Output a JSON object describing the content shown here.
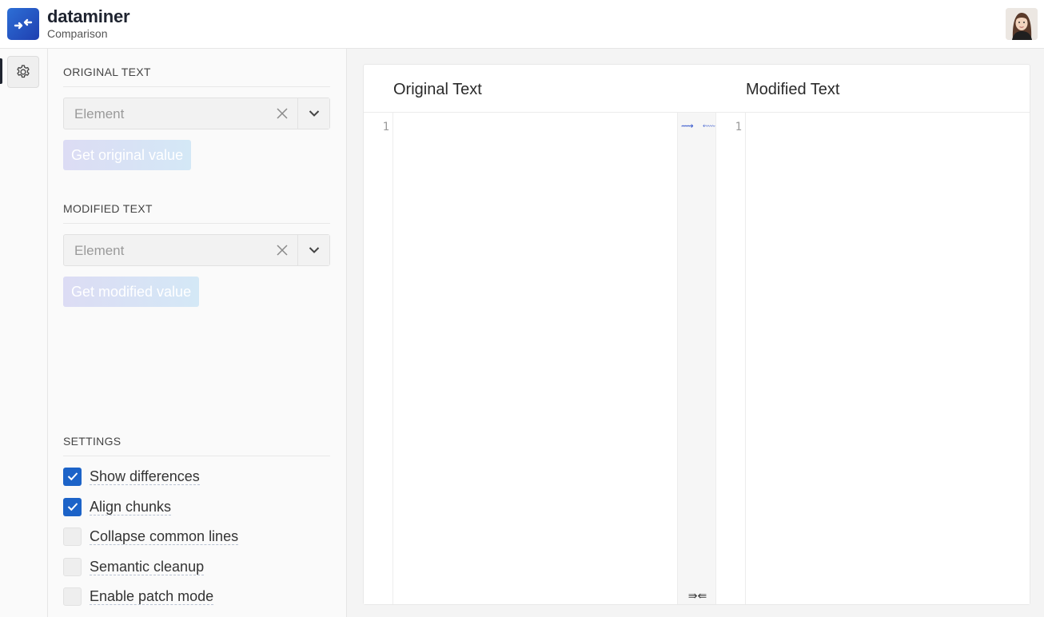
{
  "header": {
    "app_name": "dataminer",
    "app_subtitle": "Comparison"
  },
  "panel": {
    "original": {
      "title": "ORIGINAL TEXT",
      "select_placeholder": "Element",
      "button_label": "Get original value"
    },
    "modified": {
      "title": "MODIFIED TEXT",
      "select_placeholder": "Element",
      "button_label": "Get modified value"
    },
    "settings": {
      "title": "SETTINGS",
      "options": [
        {
          "label": "Show differences",
          "checked": true
        },
        {
          "label": "Align chunks",
          "checked": true
        },
        {
          "label": "Collapse common lines",
          "checked": false
        },
        {
          "label": "Semantic cleanup",
          "checked": false
        },
        {
          "label": "Enable patch mode",
          "checked": false
        }
      ]
    }
  },
  "editor": {
    "left_title": "Original Text",
    "right_title": "Modified Text",
    "left_line": "1",
    "right_line": "1",
    "merge_left_arrow": "⟿",
    "merge_right_arrow": "⬳",
    "merge_all": "⇛⇚"
  },
  "colors": {
    "accent": "#1c63c8",
    "logo": "#2650c0"
  }
}
